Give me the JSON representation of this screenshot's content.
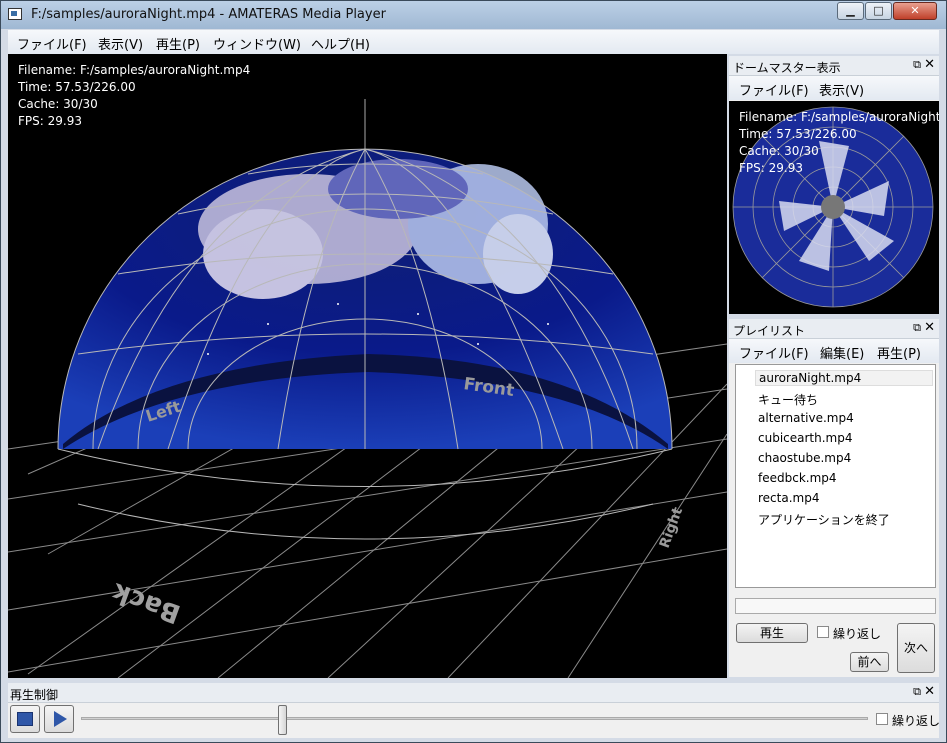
{
  "window": {
    "title": "F:/samples/auroraNight.mp4 - AMATERAS Media Player",
    "controls": {
      "minimize": "▁",
      "maximize": "□",
      "close": "✕"
    }
  },
  "menubar": [
    "ファイル(F)",
    "表示(V)",
    "再生(P)",
    "ウィンドウ(W)",
    "ヘルプ(H)"
  ],
  "viewer": {
    "osd": [
      "Filename: F:/samples/auroraNight.mp4",
      "Time: 57.53/226.00",
      "Cache: 30/30",
      "FPS: 29.93"
    ],
    "labels": {
      "front": "Front",
      "left": "Left",
      "back": "Back",
      "right": "Right"
    }
  },
  "dome_master": {
    "title": "ドームマスター表示",
    "menu": [
      "ファイル(F)",
      "表示(V)"
    ],
    "osd": [
      "Filename: F:/samples/auroraNight.mp4",
      "Time: 57.53/226.00",
      "Cache: 30/30",
      "FPS: 29.93"
    ]
  },
  "playlist": {
    "title": "プレイリスト",
    "menu": [
      "ファイル(F)",
      "編集(E)",
      "再生(P)"
    ],
    "items": [
      "auroraNight.mp4",
      "キュー待ち",
      "alternative.mp4",
      "cubicearth.mp4",
      "chaostube.mp4",
      "feedbck.mp4",
      "recta.mp4",
      "アプリケーションを終了"
    ],
    "selected_index": 0,
    "play_label": "再生",
    "loop_label": "繰り返し",
    "next_label": "次へ",
    "prev_label": "前へ"
  },
  "playback": {
    "title": "再生制御",
    "loop_label": "繰り返し",
    "position_fraction": 0.255
  },
  "panel_icons": {
    "float": "⧉",
    "close": "✕"
  }
}
